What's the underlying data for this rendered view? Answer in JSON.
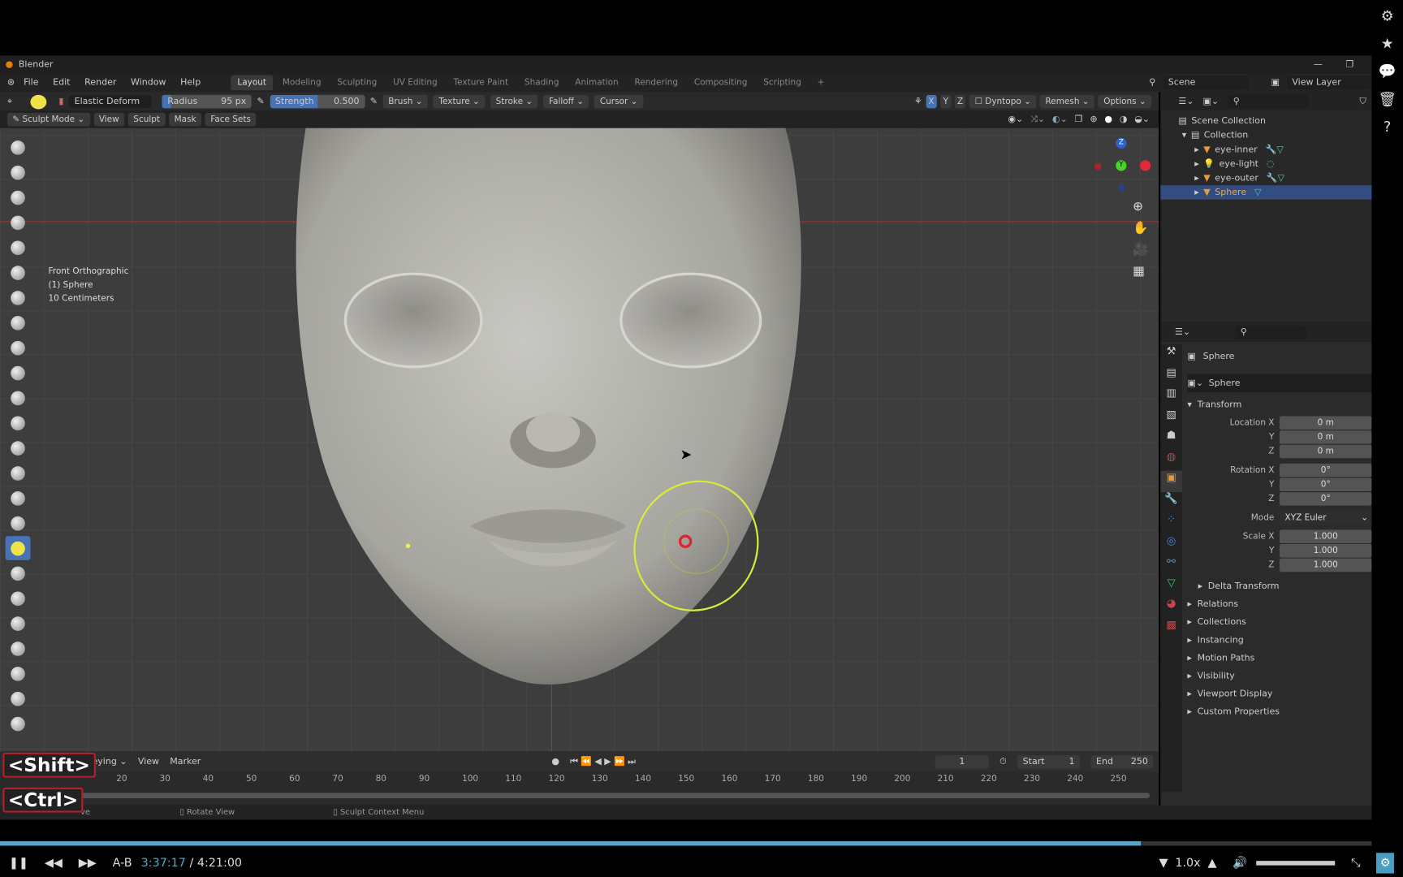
{
  "window": {
    "title": "Blender"
  },
  "menu": [
    "File",
    "Edit",
    "Render",
    "Window",
    "Help"
  ],
  "workspaces": [
    "Layout",
    "Modeling",
    "Sculpting",
    "UV Editing",
    "Texture Paint",
    "Shading",
    "Animation",
    "Rendering",
    "Compositing",
    "Scripting",
    "+"
  ],
  "scene": {
    "label": "Scene",
    "view_layer": "View Layer"
  },
  "tool_header": {
    "brush": "Elastic Deform",
    "radius_label": "Radius",
    "radius_value": "95 px",
    "strength_label": "Strength",
    "strength_value": "0.500",
    "strength_fraction": 0.5,
    "menus": [
      "Brush",
      "Texture",
      "Stroke",
      "Falloff",
      "Cursor"
    ],
    "axes": [
      "X",
      "Y",
      "Z"
    ],
    "dyntopo": "Dyntopo",
    "remesh": "Remesh",
    "options": "Options"
  },
  "viewport_header": {
    "mode": "Sculpt Mode",
    "menus": [
      "View",
      "Sculpt",
      "Mask",
      "Face Sets"
    ]
  },
  "overlay": {
    "view": "Front Orthographic",
    "object": "(1) Sphere",
    "scale": "10 Centimeters"
  },
  "gizmo": {
    "z": "Z",
    "y": "Y"
  },
  "outliner": {
    "root": "Scene Collection",
    "collection": "Collection",
    "items": [
      "eye-inner",
      "eye-light",
      "eye-outer",
      "Sphere"
    ],
    "selected": "Sphere"
  },
  "properties": {
    "object_name": "Sphere",
    "data_name": "Sphere",
    "transform": "Transform",
    "location": {
      "label": "Location X",
      "x": "0 m",
      "y": "0 m",
      "z": "0 m"
    },
    "rotation": {
      "label": "Rotation X",
      "x": "0°",
      "y": "0°",
      "z": "0°"
    },
    "mode_label": "Mode",
    "mode": "XYZ Euler",
    "scale": {
      "label": "Scale X",
      "x": "1.000",
      "y": "1.000",
      "z": "1.000"
    },
    "axis_y": "Y",
    "axis_z": "Z",
    "delta": "Delta Transform",
    "panels": [
      "Relations",
      "Collections",
      "Instancing",
      "Motion Paths",
      "Visibility",
      "Viewport Display",
      "Custom Properties"
    ]
  },
  "timeline": {
    "menus": [
      "eying",
      "View",
      "Marker"
    ],
    "current": "1",
    "start_label": "Start",
    "start": "1",
    "end_label": "End",
    "end": "250",
    "ticks": [
      "20",
      "30",
      "40",
      "50",
      "60",
      "70",
      "80",
      "90",
      "100",
      "110",
      "120",
      "130",
      "140",
      "150",
      "160",
      "170",
      "180",
      "190",
      "200",
      "210",
      "220",
      "230",
      "240",
      "250"
    ]
  },
  "statusbar": {
    "items": [
      "ve",
      "Rotate View",
      "Sculpt Context Menu"
    ]
  },
  "keys": {
    "shift": "<Shift>",
    "ctrl": "<Ctrl>"
  },
  "player": {
    "ab": "A-B",
    "time": "3:37:17",
    "duration": "/ 4:21:00",
    "speed": "1.0x",
    "progress": 0.832,
    "accent": "#5aa6c6"
  }
}
